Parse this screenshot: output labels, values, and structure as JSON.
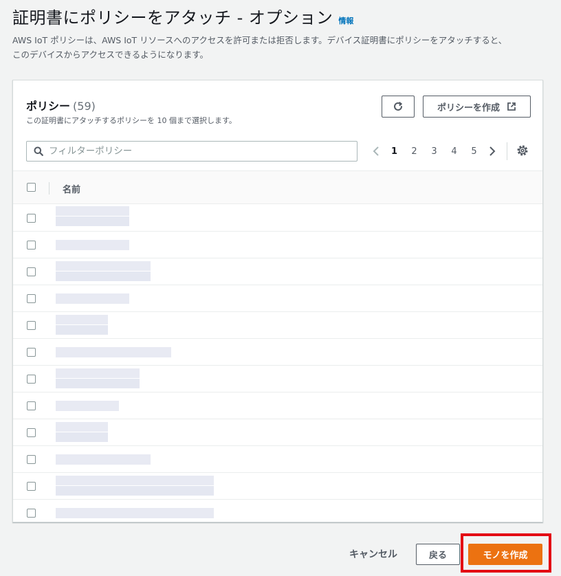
{
  "header": {
    "title": "証明書にポリシーをアタッチ - オプション",
    "info_link": "情報",
    "description_line1": "AWS IoT ポリシーは、AWS IoT リソースへのアクセスを許可または拒否します。デバイス証明書にポリシーをアタッチすると、",
    "description_line2": "このデバイスからアクセスできるようになります。"
  },
  "policies_panel": {
    "title": "ポリシー",
    "count": "(59)",
    "subtitle": "この証明書にアタッチするポリシーを 10 個まで選択します。",
    "refresh_icon": "refresh-icon",
    "create_policy_label": "ポリシーを作成",
    "external_link_icon": "external-link-icon",
    "search": {
      "placeholder": "フィルターポリシー",
      "value": "",
      "icon": "search-icon"
    },
    "pagination": {
      "pages": [
        "1",
        "2",
        "3",
        "4",
        "5"
      ],
      "current": "1"
    },
    "settings_icon": "gear-icon",
    "table": {
      "columns": [
        "名前"
      ],
      "rows": [
        {
          "selected": false
        },
        {
          "selected": false
        },
        {
          "selected": false
        },
        {
          "selected": false
        },
        {
          "selected": false
        },
        {
          "selected": false
        },
        {
          "selected": false
        },
        {
          "selected": false
        },
        {
          "selected": false
        },
        {
          "selected": false
        },
        {
          "selected": false
        },
        {
          "selected": false
        }
      ]
    }
  },
  "footer": {
    "cancel_label": "キャンセル",
    "back_label": "戻る",
    "create_label": "モノを作成"
  },
  "colors": {
    "primary": "#ec7211",
    "link": "#0073bb",
    "highlight": "#e30613"
  }
}
